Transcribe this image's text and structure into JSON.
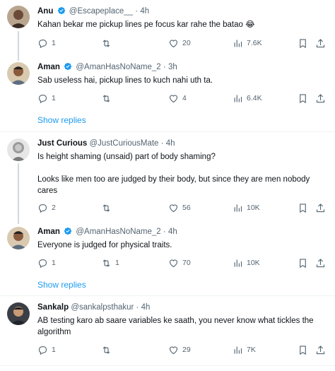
{
  "tweets": [
    {
      "name": "Anu",
      "verified": true,
      "handle": "@Escapeplace__",
      "time": "4h",
      "text": "Kahan bekar me pickup lines pe focus kar rahe the batao 😂",
      "replies": "1",
      "retweets": "",
      "likes": "20",
      "views": "7.6K"
    },
    {
      "name": "Aman",
      "verified": true,
      "handle": "@AmanHasNoName_2",
      "time": "3h",
      "text": "Sab useless hai, pickup lines to kuch nahi uth ta.",
      "replies": "1",
      "retweets": "",
      "likes": "4",
      "views": "6.4K"
    },
    {
      "name": "Just Curious",
      "verified": false,
      "handle": "@JustCuriousMate",
      "time": "4h",
      "text": "Is height shaming (unsaid) part of body shaming?\n\nLooks like men too are judged by their body, but since they are men nobody cares",
      "replies": "2",
      "retweets": "",
      "likes": "56",
      "views": "10K"
    },
    {
      "name": "Aman",
      "verified": true,
      "handle": "@AmanHasNoName_2",
      "time": "4h",
      "text": "Everyone is judged for physical traits.",
      "replies": "1",
      "retweets": "1",
      "likes": "70",
      "views": "10K"
    },
    {
      "name": "Sankalp",
      "verified": false,
      "handle": "@sankalpsthakur",
      "time": "4h",
      "text": "AB testing karo ab saare variables ke saath, you never know what tickles the algorithm",
      "replies": "1",
      "retweets": "",
      "likes": "29",
      "views": "7K"
    }
  ],
  "show_replies_label": "Show replies",
  "separator": "·",
  "colors": {
    "accent": "#1d9bf0",
    "muted": "#536471",
    "text": "#0f1419"
  }
}
